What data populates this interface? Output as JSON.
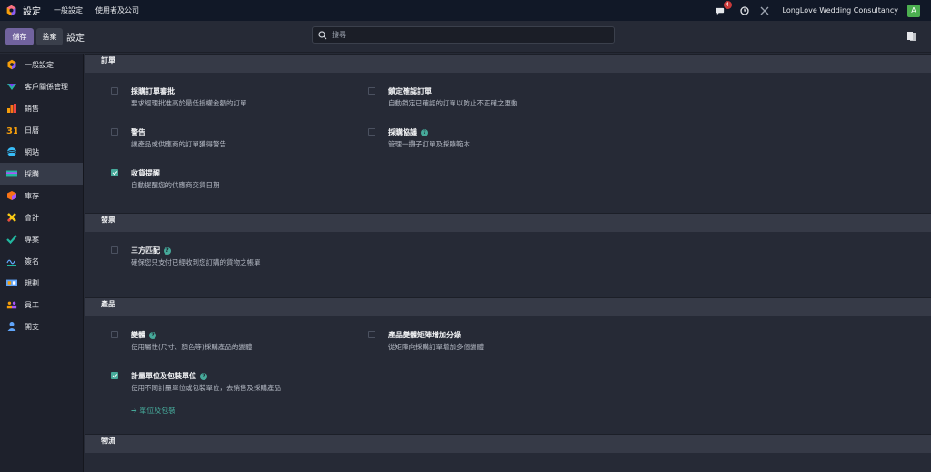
{
  "navbar": {
    "app_title": "設定",
    "menus": [
      "一般設定",
      "使用者及公司"
    ],
    "chat_badge": "4",
    "company": "LongLove Wedding Consultancy",
    "avatar_letter": "A"
  },
  "control": {
    "save_label": "儲存",
    "discard_label": "捨棄",
    "breadcrumb": "設定",
    "search_placeholder": "搜尋⋯"
  },
  "sidebar": {
    "items": [
      {
        "label": "一般設定",
        "icon": "odoo-logo-icon",
        "color": "#f59e0b"
      },
      {
        "label": "客戶關係管理",
        "icon": "crm-icon",
        "color": "#22b8a0"
      },
      {
        "label": "銷售",
        "icon": "sales-chart-icon",
        "color": "#f97316"
      },
      {
        "label": "日曆",
        "icon": "calendar-icon",
        "color": "#f59e0b"
      },
      {
        "label": "網站",
        "icon": "website-icon",
        "color": "#38bdf8"
      },
      {
        "label": "採購",
        "icon": "purchase-icon",
        "color": "#a855f7"
      },
      {
        "label": "庫存",
        "icon": "inventory-icon",
        "color": "#f97316"
      },
      {
        "label": "會計",
        "icon": "accounting-icon",
        "color": "#facc15"
      },
      {
        "label": "專案",
        "icon": "project-icon",
        "color": "#22b8a0"
      },
      {
        "label": "簽名",
        "icon": "sign-icon",
        "color": "#60a5fa"
      },
      {
        "label": "規劃",
        "icon": "planning-icon",
        "color": "#f59e0b"
      },
      {
        "label": "員工",
        "icon": "employees-icon",
        "color": "#a855f7"
      },
      {
        "label": "開支",
        "icon": "expenses-icon",
        "color": "#60a5fa"
      }
    ],
    "active_index": 5
  },
  "sections": {
    "orders": {
      "title": "訂單",
      "approval": {
        "title": "採購訂單審批",
        "desc": "要求經理批准高於最低授權金額的訂單",
        "checked": false
      },
      "lock": {
        "title": "鎖定確認訂單",
        "desc": "自動鎖定已確認的訂單以防止不正確之更動",
        "checked": false
      },
      "warning": {
        "title": "警告",
        "desc": "讓產品或供應商的訂單獲得警告",
        "checked": false
      },
      "agreements": {
        "title": "採購協議",
        "desc": "管理一攬子訂單及採購範本",
        "checked": false
      },
      "receipt": {
        "title": "收貨提醒",
        "desc": "自動提醒您的供應商交貨日期",
        "checked": true
      }
    },
    "invoicing": {
      "title": "發票",
      "three_way": {
        "title": "三方匹配",
        "desc": "確保您只支付已經收到您訂購的貨物之帳單",
        "checked": false
      }
    },
    "products": {
      "title": "產品",
      "variants": {
        "title": "變體",
        "desc": "使用屬性(尺寸、顏色等)採購產品的變體",
        "checked": false
      },
      "matrix": {
        "title": "產品變體矩陣增加分錄",
        "desc": "從矩陣向採購訂單增加多個變體",
        "checked": false
      },
      "uom": {
        "title": "計量單位及包裝單位",
        "desc": "使用不同計量單位或包裝單位，去銷售及採購產品",
        "checked": true,
        "link": "單位及包裝"
      }
    },
    "logistics": {
      "title": "物流"
    }
  }
}
